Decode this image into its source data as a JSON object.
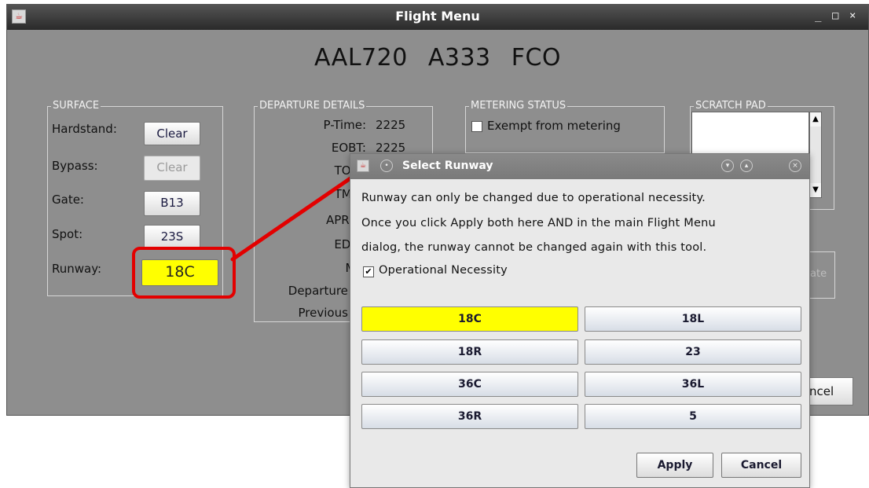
{
  "window": {
    "title": "Flight Menu",
    "controls": [
      "_",
      "□",
      "×"
    ]
  },
  "flight": {
    "callsign": "AAL720",
    "aircraft": "A333",
    "destination": "FCO"
  },
  "surface": {
    "title": "SURFACE",
    "hardstand_label": "Hardstand:",
    "hardstand_btn": "Clear",
    "bypass_label": "Bypass:",
    "bypass_btn": "Clear",
    "gate_label": "Gate:",
    "gate_value": "B13",
    "spot_label": "Spot:",
    "spot_value": "23S",
    "runway_label": "Runway:",
    "runway_value": "18C"
  },
  "departure": {
    "title": "DEPARTURE DETAILS",
    "ptime_label": "P-Time:",
    "ptime_value": "2225",
    "eobt_label": "EOBT:",
    "eobt_value": "2225",
    "tobt_label": "TOBT",
    "tmat_label": "TMAT",
    "aprec_label": "APREQ",
    "edct_label": "EDCT",
    "mit_label": "MIT",
    "dep_fix_label": "Departure fix",
    "prev_fix_label": "Previous fix"
  },
  "metering": {
    "title": "METERING STATUS",
    "exempt_label": "Exempt from metering"
  },
  "scratch": {
    "title": "SCRATCH PAD"
  },
  "behind": {
    "cancel_partial": "ncel",
    "update_partial": "ate"
  },
  "dialog": {
    "title": "Select Runway",
    "message_line1": "Runway can only be changed due to operational necessity.",
    "message_line2": "Once you click Apply both here AND in the main Flight Menu",
    "message_line3": "dialog, the runway cannot be changed again with this tool.",
    "checkbox_label": "Operational Necessity",
    "runways": [
      "18C",
      "18L",
      "18R",
      "23",
      "36C",
      "36L",
      "36R",
      "5"
    ],
    "selected_runway": "18C",
    "apply_label": "Apply",
    "cancel_label": "Cancel"
  },
  "colors": {
    "highlight": "#ffff00",
    "annotation": "#e30000"
  }
}
